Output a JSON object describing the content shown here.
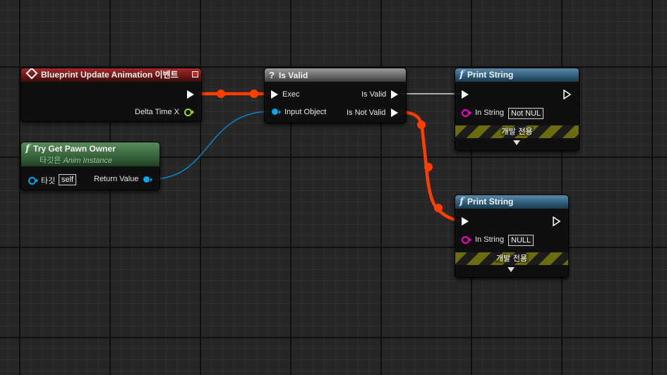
{
  "graph": {
    "colors": {
      "exec_wire_active": "#ff3d00",
      "exec_wire_inactive": "#d8d8d8",
      "object_wire": "#0a88c8",
      "object_pin": "#00a8f0",
      "float_pin": "#9ad624",
      "string_pin": "#ff00c8"
    }
  },
  "nodes": {
    "event": {
      "title": "Blueprint Update Animation 이벤트",
      "icon": "event-diamond-icon",
      "pins": {
        "delta_time": "Delta Time X"
      }
    },
    "try_get_pawn": {
      "title": "Try Get Pawn Owner",
      "subtitle_prefix": "타깃은",
      "subtitle_class": "Anim Instance",
      "icon": "function-icon",
      "pins": {
        "target": "타깃",
        "target_value": "self",
        "return_value": "Return Value"
      }
    },
    "is_valid": {
      "title": "Is Valid",
      "icon": "question-icon",
      "pins": {
        "exec": "Exec",
        "input_object": "Input Object",
        "is_valid": "Is Valid",
        "is_not_valid": "Is Not Valid"
      }
    },
    "print_string_1": {
      "title": "Print String",
      "icon": "function-icon",
      "pins": {
        "in_string": "In String",
        "in_string_value": "Not NUL"
      },
      "dev_only": "개발 전용"
    },
    "print_string_2": {
      "title": "Print String",
      "icon": "function-icon",
      "pins": {
        "in_string": "In String",
        "in_string_value": "NULL"
      },
      "dev_only": "개발 전용"
    }
  }
}
